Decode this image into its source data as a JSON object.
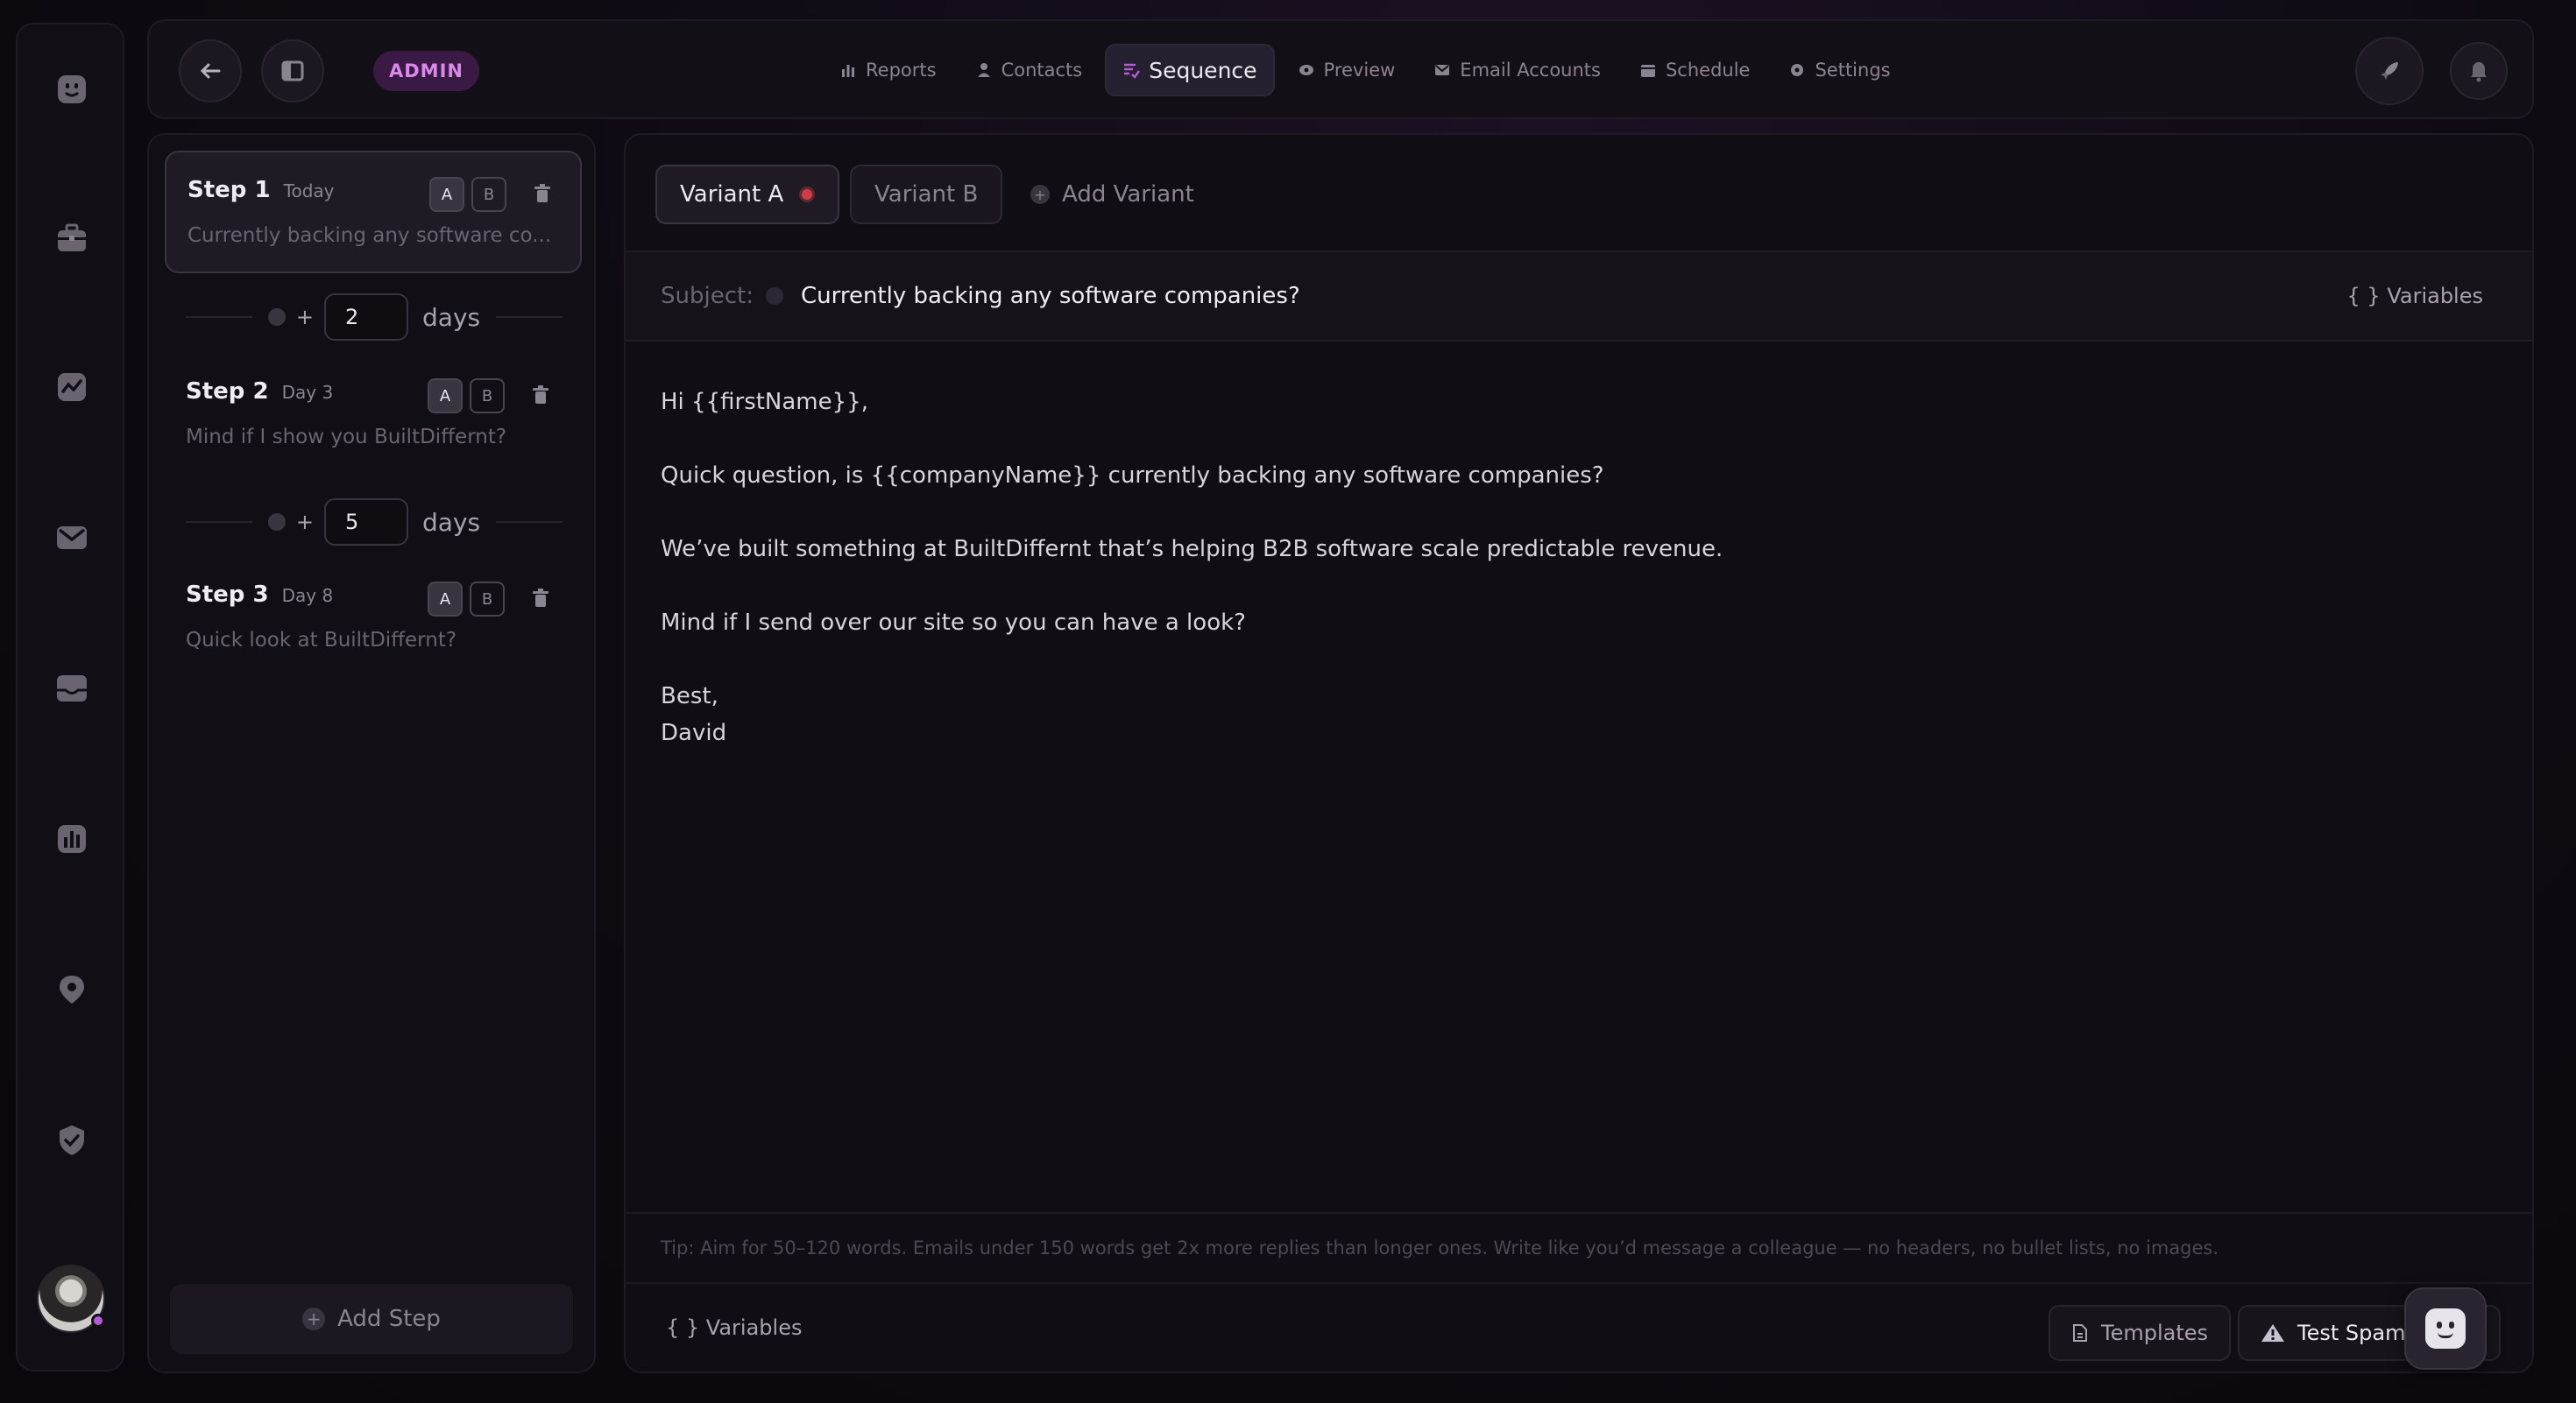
{
  "rail": {
    "icons": [
      "smiley-icon",
      "briefcase-icon",
      "analytics-icon",
      "mail-icon",
      "inbox-icon",
      "bar-chart-icon",
      "location-pin-icon",
      "shield-check-icon"
    ]
  },
  "topbar": {
    "badge": "ADMIN",
    "nav": [
      {
        "label": "Reports",
        "icon": "bar-chart-icon"
      },
      {
        "label": "Contacts",
        "icon": "person-icon"
      },
      {
        "label": "Sequence",
        "icon": "sequence-icon",
        "active": true
      },
      {
        "label": "Preview",
        "icon": "eye-icon"
      },
      {
        "label": "Email Accounts",
        "icon": "envelope-icon"
      },
      {
        "label": "Schedule",
        "icon": "calendar-icon"
      },
      {
        "label": "Settings",
        "icon": "gear-icon"
      }
    ]
  },
  "steps": [
    {
      "title": "Step 1",
      "when": "Today",
      "subject": "Currently backing any software co...",
      "a": "A",
      "b": "B",
      "active": true
    },
    {
      "title": "Step 2",
      "when": "Day 3",
      "subject": "Mind if I show you BuiltDiffernt?",
      "a": "A",
      "b": "B"
    },
    {
      "title": "Step 3",
      "when": "Day 8",
      "subject": "Quick look at BuiltDiffernt?",
      "a": "A",
      "b": "B"
    }
  ],
  "delays": [
    {
      "plus": "+",
      "value": "2",
      "unit": "days"
    },
    {
      "plus": "+",
      "value": "5",
      "unit": "days"
    }
  ],
  "add_step_label": "Add Step",
  "editor": {
    "variant_a": "Variant A",
    "variant_b": "Variant B",
    "add_variant": "Add Variant",
    "subject_label": "Subject:",
    "subject": "Currently backing any software companies?",
    "variables_label": "{ } Variables",
    "body": {
      "greeting": "Hi {{firstName}},",
      "p1": "Quick question, is {{companyName}} currently backing any software companies?",
      "p2": "We’ve built something at BuiltDiffernt that’s helping B2B software scale predictable revenue.",
      "p3": "Mind if I send over our site so you can have a look?",
      "signoff": "Best,",
      "name": "David"
    },
    "tip": "Tip: Aim for 50–120 words. Emails under 150 words get 2x more replies than longer ones. Write like you’d message a colleague — no headers, no bullet lists, no images.",
    "bottom_variables": "{ } Variables",
    "templates_label": "Templates",
    "test_spam_label": "Test Spam"
  },
  "colors": {
    "accent": "#b45ad8",
    "alert": "#d23a4a"
  }
}
